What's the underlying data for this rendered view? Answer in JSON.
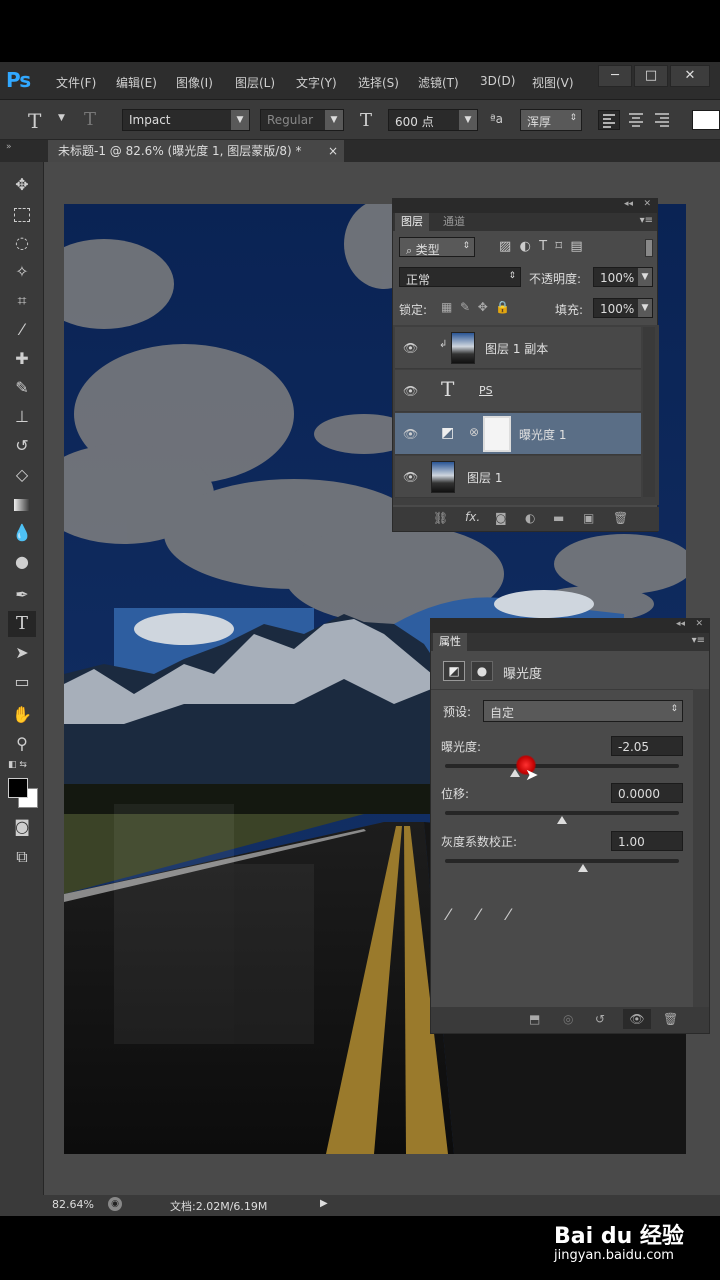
{
  "app": {
    "logo": "Ps"
  },
  "menubar": {
    "items": [
      "文件(F)",
      "编辑(E)",
      "图像(I)",
      "图层(L)",
      "文字(Y)",
      "选择(S)",
      "滤镜(T)",
      "3D(D)",
      "视图(V)"
    ],
    "window_buttons": [
      "─",
      "□",
      "✕"
    ]
  },
  "options": {
    "font_family": "Impact",
    "font_style": "Regular",
    "font_size": "600 点",
    "antialias_label": "ªa",
    "antialias": "浑厚"
  },
  "document_tab": {
    "title": "未标题-1 @ 82.6% (曝光度 1, 图层蒙版/8) *",
    "close": "×"
  },
  "layers_panel": {
    "tabs": [
      "图层",
      "通道"
    ],
    "filter_kind": "类型",
    "blend_mode": "正常",
    "opacity_label": "不透明度:",
    "opacity_value": "100%",
    "lock_label": "锁定:",
    "fill_label": "填充:",
    "fill_value": "100%",
    "layers": [
      {
        "name": "图层 1 副本",
        "type": "image",
        "clipped": true
      },
      {
        "name": "PS",
        "type": "text"
      },
      {
        "name": "曝光度 1",
        "type": "adjustment",
        "selected": true
      },
      {
        "name": "图层 1",
        "type": "image"
      }
    ],
    "footer_icons": [
      "link-icon",
      "fx-icon",
      "mask-icon",
      "adjustment-icon",
      "folder-icon",
      "new-layer-icon",
      "trash-icon"
    ],
    "fx_label": "fx."
  },
  "properties_panel": {
    "tab": "属性",
    "title": "曝光度",
    "preset_label": "预设:",
    "preset_value": "自定",
    "exposure_label": "曝光度:",
    "exposure_value": "-2.05",
    "exposure_fraction": 0.3,
    "offset_label": "位移:",
    "offset_value": "0.0000",
    "offset_fraction": 0.5,
    "gamma_label": "灰度系数校正:",
    "gamma_value": "1.00",
    "gamma_fraction": 0.59
  },
  "status": {
    "zoom": "82.64%",
    "doc_size": "文档:2.02M/6.19M"
  },
  "watermark": {
    "brand": "Bai du 经验",
    "url": "jingyan.baidu.com"
  },
  "colors": {
    "accent": "#31a8ff",
    "selected_layer": "#5a6e86",
    "bg": "#535353"
  }
}
